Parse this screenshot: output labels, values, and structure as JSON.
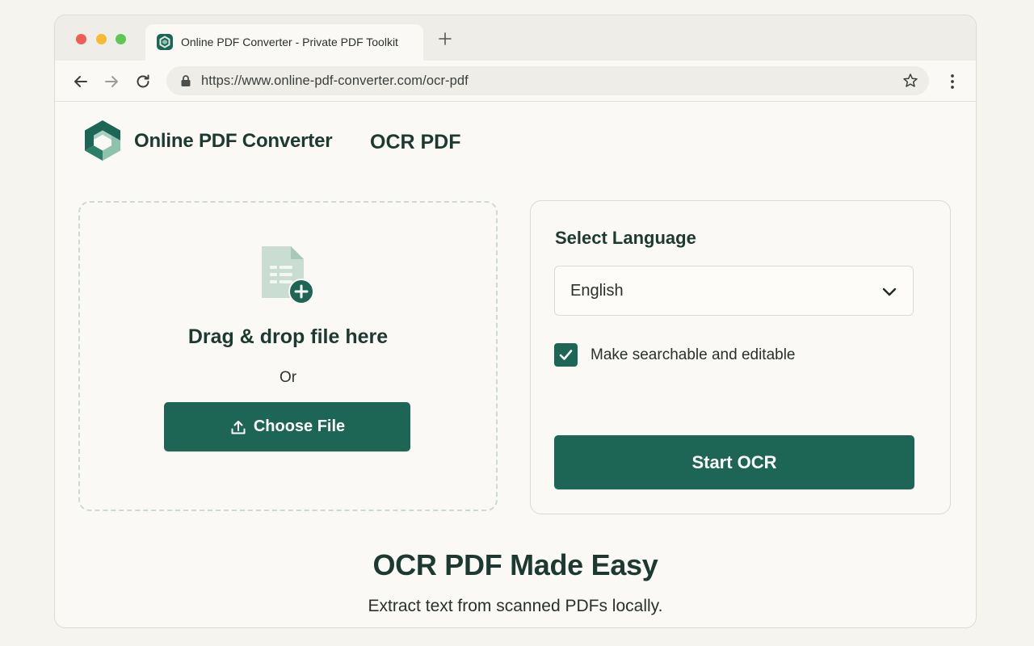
{
  "browser": {
    "tab_title": "Online PDF Converter - Private PDF Toolkit",
    "new_tab_icon": "plus-icon",
    "url": "https://www.online-pdf-converter.com/ocr-pdf"
  },
  "header": {
    "brand_name": "Online PDF Converter",
    "page_title": "OCR PDF"
  },
  "upload": {
    "drop_title": "Drag & drop file here",
    "or_text": "Or",
    "choose_label": "Choose File"
  },
  "options": {
    "panel_title": "Select Language",
    "language_selected": "English",
    "searchable_label": "Make searchable and editable",
    "searchable_checked": true,
    "start_label": "Start OCR"
  },
  "hero": {
    "title": "OCR PDF Made Easy",
    "subtitle": "Extract text from scanned PDFs locally."
  },
  "colors": {
    "accent": "#1d6655",
    "heading": "#1c3a31",
    "background": "#faf9f5"
  }
}
